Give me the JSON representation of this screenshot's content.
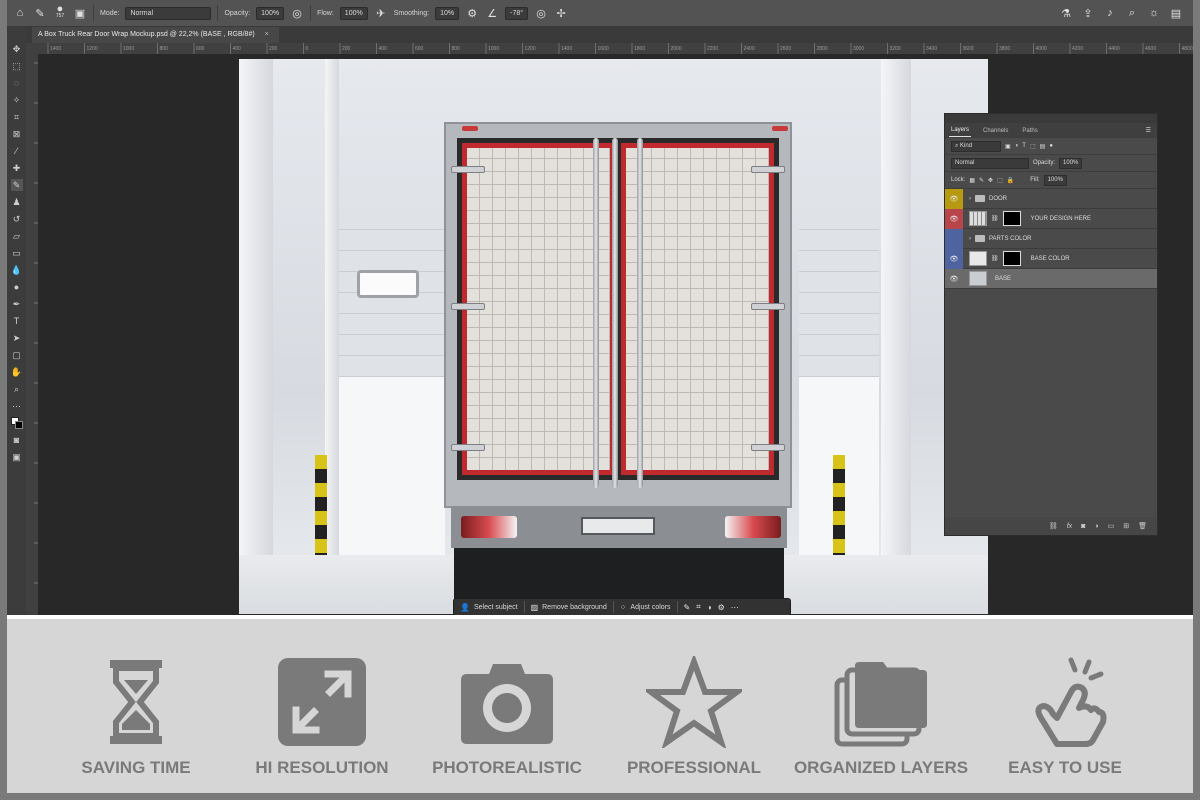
{
  "app": {
    "document_tab": "A Box Truck Rear Door Wrap Mockup.psd @ 22,2% (BASE , RGB/8#)",
    "document_tab_close": "×"
  },
  "options_bar": {
    "brush_size": "757",
    "mode_label": "Mode:",
    "mode_value": "Normal",
    "opacity_label": "Opacity:",
    "opacity_value": "100%",
    "flow_label": "Flow:",
    "flow_value": "100%",
    "smoothing_label": "Smoothing:",
    "smoothing_value": "10%",
    "angle_value": "-78°"
  },
  "ruler_ticks": [
    "1400",
    "1200",
    "1000",
    "800",
    "600",
    "400",
    "200",
    "0",
    "200",
    "400",
    "600",
    "800",
    "1000",
    "1200",
    "1400",
    "1600",
    "1800",
    "2000",
    "2200",
    "2400",
    "2600",
    "2800",
    "3000",
    "3200",
    "3400",
    "3600",
    "3800",
    "4000",
    "4200",
    "4400",
    "4600",
    "4800"
  ],
  "taskbar": {
    "select_subject": "Select subject",
    "remove_background": "Remove background",
    "adjust_colors": "Adjust colors"
  },
  "layers_panel": {
    "tabs": [
      "Layers",
      "Channels",
      "Paths"
    ],
    "filter_kind": "Kind",
    "blend_mode": "Normal",
    "opacity_label": "Opacity:",
    "opacity_value": "100%",
    "lock_label": "Lock:",
    "fill_label": "Fill:",
    "fill_value": "100%",
    "layers": [
      {
        "name": "DOOR",
        "color": "#c9a810",
        "type": "group"
      },
      {
        "name": "YOUR DESIGN HERE",
        "color": "#c94b4f",
        "type": "smart"
      },
      {
        "name": "PARTS COLOR",
        "color": "#5470a8",
        "type": "group"
      },
      {
        "name": "BASE COLOR",
        "color": "#5470a8",
        "type": "fill"
      },
      {
        "name": "BASE",
        "color": "",
        "type": "image",
        "selected": true
      }
    ]
  },
  "features": [
    {
      "label": "SAVING TIME",
      "icon": "hourglass-icon"
    },
    {
      "label": "HI RESOLUTION",
      "icon": "expand-arrows-icon"
    },
    {
      "label": "PHOTOREALISTIC",
      "icon": "camera-icon"
    },
    {
      "label": "PROFESSIONAL",
      "icon": "star-icon"
    },
    {
      "label": "ORGANIZED LAYERS",
      "icon": "stacked-layers-icon"
    },
    {
      "label": "EASY TO USE",
      "icon": "pointing-hand-icon"
    }
  ],
  "colors": {
    "feature_gray": "#7a7a7a",
    "door_trim_red": "#c02a2f"
  }
}
